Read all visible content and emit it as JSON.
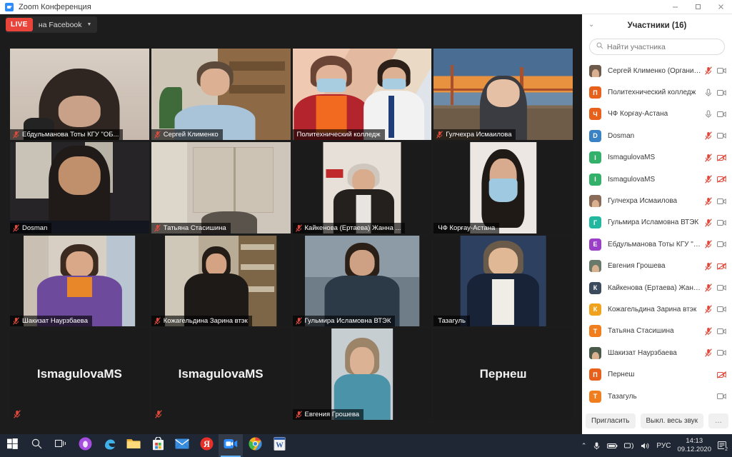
{
  "window": {
    "title": "Zoom Конференция",
    "app_icon": "zoom-camera-icon",
    "minimize": "minimize-icon",
    "maximize": "maximize-icon",
    "close": "close-icon"
  },
  "toolbar": {
    "live_badge": "LIVE",
    "live_target": "на Facebook",
    "caret": "▼"
  },
  "grid": {
    "tiles": [
      {
        "name": "Ебдульманова Тоты  КГУ \"ОБ...",
        "muted": true,
        "active": false,
        "video": true,
        "bg": "#cdbfb4",
        "inner": "#3a2d26",
        "style": "woman-dark-hair",
        "label_x": 0
      },
      {
        "name": "Сергей Клименко",
        "muted": true,
        "active": false,
        "video": true,
        "bg": "#b5a48c",
        "inner": "#7d6a52",
        "style": "man-office",
        "label_x": 0
      },
      {
        "name": "Политехнический колледж",
        "muted": false,
        "active": false,
        "video": true,
        "bg": "#d9b9a8",
        "inner": "#c98f7e",
        "style": "two-women-masks",
        "label_x": 0
      },
      {
        "name": "Гулчехра Исмаилова",
        "muted": true,
        "active": false,
        "video": true,
        "bg": "#2b4c6b",
        "inner": "#e8913f",
        "style": "bridge-sunset",
        "label_x": 0
      },
      {
        "name": "Dosman",
        "muted": true,
        "active": false,
        "video": true,
        "bg": "#2a2a2c",
        "inner": "#6b5a4e",
        "style": "woman-dark-room",
        "label_x": 0
      },
      {
        "name": "Татьяна Стасишина",
        "muted": true,
        "active": false,
        "video": true,
        "bg": "#b9b2ab",
        "inner": "#9a9189",
        "style": "room-cabinet",
        "label_x": 0
      },
      {
        "name": "Кайкенова (Ертаева) Жанна ...",
        "muted": true,
        "active": false,
        "video": true,
        "bg": "#1b1b1b",
        "inner": "#ddd6cf",
        "style": "woman-portrait-narrow",
        "label_x": 0
      },
      {
        "name": "ЧФ Корғау-Астана",
        "muted": false,
        "active": true,
        "video": true,
        "bg": "#1b1b1b",
        "inner": "#e2ddd8",
        "style": "woman-mask-narrow",
        "label_x": 0
      },
      {
        "name": "Шакизат Наурзбаева",
        "muted": true,
        "active": false,
        "video": true,
        "bg": "#1b1b1b",
        "inner": "#7d5f9c",
        "style": "woman-purple-narrow",
        "label_x": 0
      },
      {
        "name": "Кожагельдина Зарина втэк",
        "muted": true,
        "active": false,
        "video": true,
        "bg": "#1b1b1b",
        "inner": "#8a7a63",
        "style": "woman-bookshelf-narrow",
        "label_x": 0
      },
      {
        "name": "Гульмира Исламовна ВТЭК",
        "muted": true,
        "active": false,
        "video": true,
        "bg": "#1b1b1b",
        "inner": "#5f6d7e",
        "style": "woman-blue-narrow",
        "label_x": 0
      },
      {
        "name": "Тазагуль",
        "muted": false,
        "active": false,
        "video": true,
        "bg": "#1b1b1b",
        "inner": "#2c3f5c",
        "style": "woman-glasses-narrow",
        "label_x": 0
      },
      {
        "name": "IsmagulovaMS",
        "muted": true,
        "active": false,
        "video": false,
        "bg": "#1b1b1b",
        "inner": "#1b1b1b",
        "style": "placeholder",
        "label_x": 0
      },
      {
        "name": "IsmagulovaMS",
        "muted": true,
        "active": false,
        "video": false,
        "bg": "#1b1b1b",
        "inner": "#1b1b1b",
        "style": "placeholder",
        "label_x": 0
      },
      {
        "name": "Евгения Грошева",
        "muted": true,
        "active": false,
        "video": true,
        "bg": "#1b1b1b",
        "inner": "#b9c3c7",
        "style": "woman-teal-narrow",
        "label_x": 0
      },
      {
        "name": "Пернеш",
        "muted": false,
        "active": false,
        "video": false,
        "bg": "#1b1b1b",
        "inner": "#1b1b1b",
        "style": "placeholder",
        "label_x": 0
      }
    ]
  },
  "panel": {
    "chevron": "⌄",
    "title": "Участники (16)",
    "search_placeholder": "Найти участника",
    "search_value": "",
    "search_icon": "search-icon",
    "participants": [
      {
        "name": "Сергей Клименко (Организатор, я)",
        "initial": "",
        "color": "#6e5a4a",
        "photo": true,
        "mic": "muted",
        "cam": "on"
      },
      {
        "name": "Политехнический колледж",
        "initial": "П",
        "color": "#e8611c",
        "photo": false,
        "mic": "unmuted",
        "cam": "on"
      },
      {
        "name": "ЧФ Корғау-Астана",
        "initial": "Ч",
        "color": "#e8611c",
        "photo": false,
        "mic": "unmuted",
        "cam": "on"
      },
      {
        "name": "Dosman",
        "initial": "D",
        "color": "#3a82c4",
        "photo": false,
        "mic": "muted",
        "cam": "on"
      },
      {
        "name": "IsmagulovaMS",
        "initial": "I",
        "color": "#33b06a",
        "photo": false,
        "mic": "muted",
        "cam": "off"
      },
      {
        "name": "IsmagulovaMS",
        "initial": "I",
        "color": "#33b06a",
        "photo": false,
        "mic": "muted",
        "cam": "off"
      },
      {
        "name": "Гулчехра Исмаилова",
        "initial": "",
        "color": "#8a6b58",
        "photo": true,
        "mic": "muted",
        "cam": "on"
      },
      {
        "name": "Гульмира Исламовна ВТЭК",
        "initial": "Г",
        "color": "#22b8a0",
        "photo": false,
        "mic": "muted",
        "cam": "on"
      },
      {
        "name": "Ебдульманова Тоты  КГУ \"Област...",
        "initial": "Е",
        "color": "#9b3fc9",
        "photo": false,
        "mic": "muted",
        "cam": "on"
      },
      {
        "name": "Евгения Грошева",
        "initial": "",
        "color": "#6a7a6a",
        "photo": true,
        "mic": "muted",
        "cam": "off"
      },
      {
        "name": "Кайкенова (Ертаева) Жанна ОФ \"...",
        "initial": "К",
        "color": "#3b4a5c",
        "photo": false,
        "mic": "muted",
        "cam": "on"
      },
      {
        "name": "Кожагельдина Зарина втэк",
        "initial": "К",
        "color": "#f0a11e",
        "photo": false,
        "mic": "muted",
        "cam": "on"
      },
      {
        "name": "Татьяна Стасишина",
        "initial": "Т",
        "color": "#f07d1e",
        "photo": false,
        "mic": "muted",
        "cam": "on"
      },
      {
        "name": "Шакизат Наурзбаева",
        "initial": "",
        "color": "#4a5a4a",
        "photo": true,
        "mic": "muted",
        "cam": "on"
      },
      {
        "name": "Пернеш",
        "initial": "П",
        "color": "#e8611c",
        "photo": false,
        "mic": "none",
        "cam": "off"
      },
      {
        "name": "Тазагуль",
        "initial": "Т",
        "color": "#f07d1e",
        "photo": false,
        "mic": "none",
        "cam": "on"
      }
    ],
    "invite_label": "Пригласить",
    "mute_all_label": "Выкл. весь звук",
    "more_label": "…"
  },
  "taskbar": {
    "items": [
      {
        "icon": "windows-start-icon",
        "name": "start-button",
        "active": false
      },
      {
        "icon": "search-icon",
        "name": "taskbar-search",
        "active": false
      },
      {
        "icon": "task-view-icon",
        "name": "task-view-button",
        "active": false
      },
      {
        "icon": "purple-drop-icon",
        "name": "taskbar-app-purple",
        "active": false
      },
      {
        "icon": "edge-icon",
        "name": "taskbar-edge",
        "active": false
      },
      {
        "icon": "file-explorer-icon",
        "name": "taskbar-explorer",
        "active": false
      },
      {
        "icon": "microsoft-store-icon",
        "name": "taskbar-store",
        "active": false
      },
      {
        "icon": "mail-icon",
        "name": "taskbar-mail",
        "active": false
      },
      {
        "icon": "yandex-icon",
        "name": "taskbar-yandex",
        "active": false
      },
      {
        "icon": "zoom-icon",
        "name": "taskbar-zoom",
        "active": true
      },
      {
        "icon": "chrome-icon",
        "name": "taskbar-chrome",
        "active": false
      },
      {
        "icon": "word-icon",
        "name": "taskbar-word",
        "active": false
      }
    ],
    "tray": {
      "chevron": "⌃",
      "mic": "microphone-icon",
      "battery": "battery-icon",
      "network": "network-icon",
      "volume": "volume-icon",
      "language": "РУС",
      "time": "14:13",
      "date": "09.12.2020",
      "notifications": "2"
    }
  }
}
